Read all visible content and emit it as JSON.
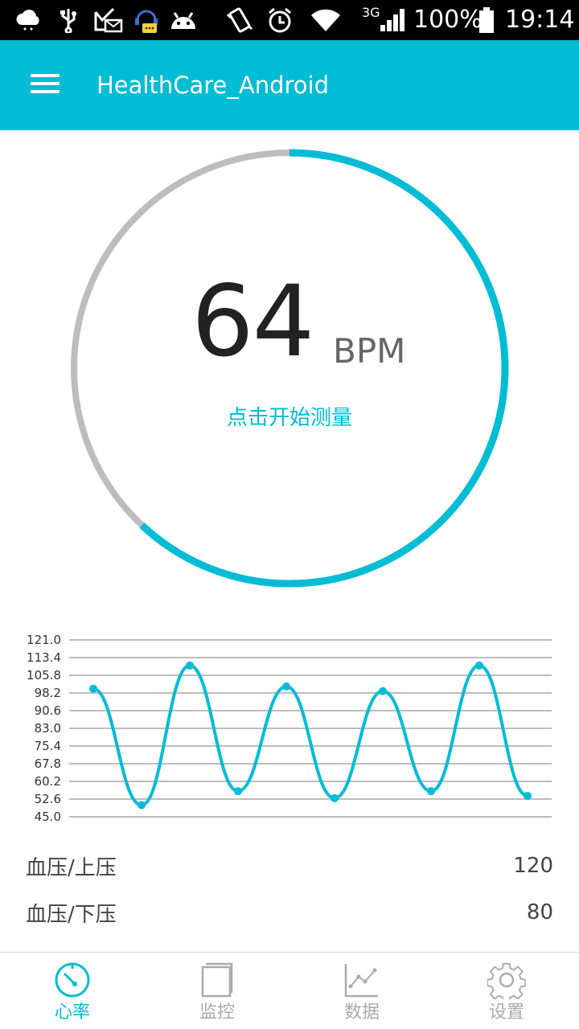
{
  "status_bar": {
    "battery_percent": "100%",
    "time": "19:14",
    "network": "3G",
    "icons": [
      "weather-cloud-icon",
      "usb-icon",
      "mail-check-icon",
      "chat-bubble-icon",
      "android-icon",
      "vibrate-icon",
      "alarm-icon",
      "wifi-icon",
      "signal-icon",
      "battery-icon"
    ]
  },
  "app_bar": {
    "title": "HealthCare_Android"
  },
  "gauge": {
    "value": "64",
    "unit": "BPM",
    "action_text": "点击开始测量",
    "progress_fraction": 0.62,
    "colors": {
      "progress": "#00BCD4",
      "track": "#BDBDBD"
    }
  },
  "chart_data": {
    "type": "line",
    "y_ticks": [
      "121.0",
      "113.4",
      "105.8",
      "98.2",
      "90.6",
      "83.0",
      "75.4",
      "67.8",
      "60.2",
      "52.6",
      "45.0"
    ],
    "ylim": [
      45.0,
      121.0
    ],
    "x": [
      0,
      1,
      2,
      3,
      4,
      5,
      6,
      7,
      8,
      9
    ],
    "series": [
      {
        "values": [
          100,
          50,
          110,
          56,
          101,
          53,
          99,
          56,
          110,
          54
        ]
      }
    ],
    "color": "#00BCD4",
    "grid": true
  },
  "blood_pressure": [
    {
      "label": "血压/上压",
      "value": "120"
    },
    {
      "label": "血压/下压",
      "value": "80"
    }
  ],
  "bottom_nav": {
    "items": [
      {
        "label": "心率",
        "icon": "heart-rate-gauge-icon",
        "active": true
      },
      {
        "label": "监控",
        "icon": "monitor-book-icon",
        "active": false
      },
      {
        "label": "数据",
        "icon": "data-chart-icon",
        "active": false
      },
      {
        "label": "设置",
        "icon": "settings-gear-icon",
        "active": false
      }
    ],
    "colors": {
      "active": "#00BCD4",
      "inactive": "#AAAAAA"
    }
  }
}
